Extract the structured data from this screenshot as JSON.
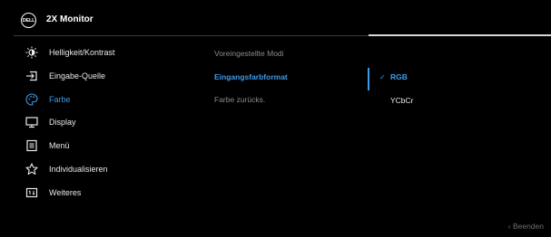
{
  "header": {
    "logo_text": "DELL",
    "title": "2X Monitor"
  },
  "menu": {
    "items": [
      {
        "label": "Helligkeit/Kontrast",
        "icon": "brightness-icon"
      },
      {
        "label": "Eingabe-Quelle",
        "icon": "input-source-icon"
      },
      {
        "label": "Farbe",
        "icon": "palette-icon"
      },
      {
        "label": "Display",
        "icon": "display-icon"
      },
      {
        "label": "Menü",
        "icon": "menu-icon"
      },
      {
        "label": "Individualisieren",
        "icon": "star-icon"
      },
      {
        "label": "Weiteres",
        "icon": "others-icon"
      }
    ],
    "active_label": "Farbe"
  },
  "submenu": {
    "items": [
      {
        "label": "Voreingestellte Modi"
      },
      {
        "label": "Eingangsfarbformat"
      },
      {
        "label": "Farbe zurücks."
      }
    ],
    "selected_label": "Eingangsfarbformat"
  },
  "options": {
    "items": [
      {
        "label": "RGB"
      },
      {
        "label": "YCbCr"
      }
    ],
    "selected_label": "RGB",
    "check_glyph": "✓"
  },
  "footer": {
    "exit_label": "‹ Beenden"
  },
  "colors": {
    "accent": "#3d9bea",
    "background": "#000000"
  }
}
